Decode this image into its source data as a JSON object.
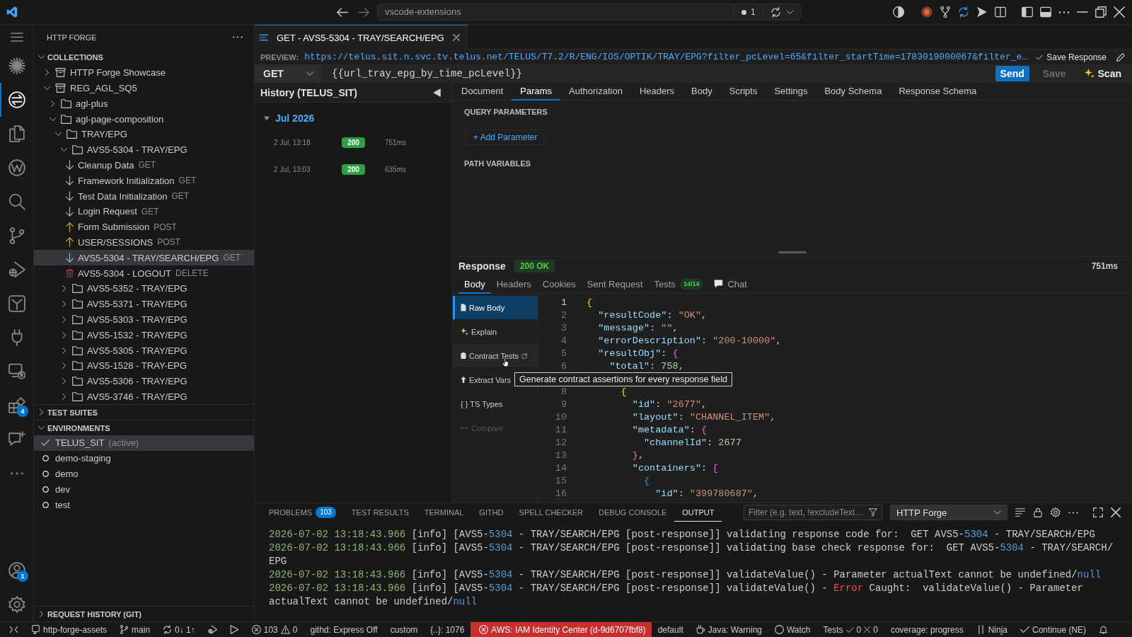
{
  "title_bar": {
    "search": "vscode-extensions",
    "indicator": "1"
  },
  "activity_bar": {
    "items": [
      {
        "kind": "menu",
        "selected": false
      },
      {
        "kind": "sparkle",
        "selected": false
      },
      {
        "kind": "forge",
        "selected": true
      },
      {
        "kind": "files",
        "selected": false
      },
      {
        "kind": "wiki",
        "selected": false
      },
      {
        "kind": "search",
        "selected": false
      },
      {
        "kind": "branch",
        "selected": false
      },
      {
        "kind": "debug",
        "selected": false
      },
      {
        "kind": "tile",
        "selected": false
      },
      {
        "kind": "plug",
        "selected": false
      },
      {
        "kind": "remote",
        "selected": false
      },
      {
        "kind": "extensions",
        "selected": false,
        "badge": "4"
      },
      {
        "kind": "chat",
        "selected": false
      },
      {
        "kind": "more",
        "selected": false
      }
    ],
    "bottom_items": [
      {
        "kind": "account",
        "badge": "1"
      },
      {
        "kind": "settings"
      }
    ]
  },
  "sidebar": {
    "title": "HTTP FORGE",
    "collections": {
      "title": "COLLECTIONS",
      "expanded": true,
      "items": [
        {
          "kind": "collection",
          "label": "HTTP Forge Showcase",
          "expanded": false,
          "selected": false
        },
        {
          "kind": "collection",
          "label": "REG_AGL_SQ5",
          "expanded": true,
          "selected": false,
          "children": [
            {
              "kind": "folder",
              "label": "agl-plus",
              "expanded": false,
              "selected": false
            },
            {
              "kind": "folder",
              "label": "agl-page-composition",
              "expanded": true,
              "selected": false,
              "children": [
                {
                  "kind": "folder",
                  "label": "TRAY/EPG",
                  "expanded": true,
                  "selected": false,
                  "children": [
                    {
                      "kind": "folder",
                      "label": "AVS5-5304 - TRAY/EPG",
                      "expanded": true,
                      "selected": false,
                      "children": [
                        {
                          "kind": "get",
                          "label": "Cleanup Data",
                          "method": "GET",
                          "selected": false
                        },
                        {
                          "kind": "get",
                          "label": "Framework Initialization",
                          "method": "GET",
                          "selected": false
                        },
                        {
                          "kind": "get",
                          "label": "Test Data Initialization",
                          "method": "GET",
                          "selected": false
                        },
                        {
                          "kind": "get",
                          "label": "Login Request",
                          "method": "GET",
                          "selected": false
                        },
                        {
                          "kind": "post",
                          "label": "Form Submission",
                          "method": "POST",
                          "selected": false
                        },
                        {
                          "kind": "post",
                          "label": "USER/SESSIONS",
                          "method": "POST",
                          "selected": false
                        },
                        {
                          "kind": "get",
                          "label": "AVS5-5304 - TRAY/SEARCH/EPG",
                          "method": "GET",
                          "selected": true
                        },
                        {
                          "kind": "delete",
                          "label": "AVS5-5304 - LOGOUT",
                          "method": "DELETE",
                          "selected": false
                        }
                      ]
                    },
                    {
                      "kind": "folder",
                      "label": "AVS5-5352 - TRAY/EPG",
                      "expanded": false,
                      "selected": false
                    },
                    {
                      "kind": "folder",
                      "label": "AVS5-5371 - TRAY/EPG",
                      "expanded": false,
                      "selected": false
                    },
                    {
                      "kind": "folder",
                      "label": "AVS5-5303 - TRAY/EPG",
                      "expanded": false,
                      "selected": false
                    },
                    {
                      "kind": "folder",
                      "label": "AVS5-1532 - TRAY/EPG",
                      "expanded": false,
                      "selected": false
                    },
                    {
                      "kind": "folder",
                      "label": "AVS5-5305 - TRAY/EPG",
                      "expanded": false,
                      "selected": false
                    },
                    {
                      "kind": "folder",
                      "label": "AVS5-1528 - TRAY-EPG",
                      "expanded": false,
                      "selected": false
                    },
                    {
                      "kind": "folder",
                      "label": "AVS5-5306 - TRAY/EPG",
                      "expanded": false,
                      "selected": false
                    },
                    {
                      "kind": "folder",
                      "label": "AVS5-3746 - TRAY/EPG",
                      "expanded": false,
                      "selected": false
                    }
                  ]
                }
              ]
            }
          ]
        }
      ]
    },
    "test_suites": {
      "title": "TEST SUITES",
      "expanded": false
    },
    "environments": {
      "title": "ENVIRONMENTS",
      "expanded": true,
      "items": [
        {
          "name": "TELUS_SIT",
          "note": "(active)",
          "selected": true
        },
        {
          "name": "demo-staging",
          "selected": false
        },
        {
          "name": "demo",
          "selected": false
        },
        {
          "name": "dev",
          "selected": false
        },
        {
          "name": "test",
          "selected": false
        }
      ]
    },
    "request_history": {
      "title": "REQUEST HISTORY (GIT)",
      "expanded": false
    }
  },
  "editor": {
    "tabs": [
      {
        "label": "GET - AVS5-5304 - TRAY/SEARCH/EPG",
        "selected": true
      }
    ],
    "preview": {
      "label": "PREVIEW:",
      "url": "https://telus.sit.n.svc.tv.telus.net/TELUS/T7.2/R/ENG/IOS/OPTIK/TRAY/EPG?filter_pcLevel=65&filter_startTime=1783019000067&filter_e…",
      "save_response": {
        "label": "Save Response",
        "checked": true
      }
    },
    "request": {
      "method": "GET",
      "url": "{{url_tray_epg_by_time_pcLevel}}",
      "actions": [
        {
          "label": "Send",
          "kind": "primary",
          "disabled": false
        },
        {
          "label": "Save",
          "kind": "plain",
          "disabled": true
        },
        {
          "label": "Scan",
          "kind": "ai",
          "disabled": false
        }
      ]
    },
    "history": {
      "title": "History (TELUS_SIT)",
      "groups": [
        {
          "label": "Jul 2026",
          "expanded": true,
          "entries": [
            {
              "time": "2 Jul, 13:18",
              "status": "200",
              "duration": "751ms"
            },
            {
              "time": "2 Jul, 13:03",
              "status": "200",
              "duration": "635ms"
            }
          ]
        }
      ]
    },
    "request_tabs": [
      {
        "label": "Document",
        "selected": false
      },
      {
        "label": "Params",
        "selected": true
      },
      {
        "label": "Authorization",
        "selected": false
      },
      {
        "label": "Headers",
        "selected": false
      },
      {
        "label": "Body",
        "selected": false
      },
      {
        "label": "Scripts",
        "selected": false
      },
      {
        "label": "Settings",
        "selected": false
      },
      {
        "label": "Body Schema",
        "selected": false
      },
      {
        "label": "Response Schema",
        "selected": false
      }
    ],
    "params": {
      "sections": [
        {
          "title": "QUERY PARAMETERS",
          "action": "+ Add Parameter"
        },
        {
          "title": "PATH VARIABLES"
        }
      ]
    },
    "response": {
      "title": "Response",
      "status": "200 OK",
      "time": "751ms",
      "tabs": [
        {
          "label": "Body",
          "kind": "view",
          "selected": true
        },
        {
          "label": "Headers",
          "kind": "view",
          "selected": false
        },
        {
          "label": "Cookies",
          "kind": "view",
          "selected": false
        },
        {
          "label": "Sent Request",
          "kind": "view",
          "selected": false
        },
        {
          "label": "Tests",
          "kind": "view",
          "badge": "14/14",
          "selected": false
        },
        {
          "label": "Chat",
          "kind": "chat",
          "selected": false
        }
      ],
      "actions": [
        {
          "label": "Raw Body",
          "kind": "page",
          "selected": true,
          "hovered": false,
          "disabled": false,
          "loading": false
        },
        {
          "label": "Explain",
          "kind": "sparkle",
          "selected": false,
          "hovered": false,
          "disabled": false,
          "loading": false
        },
        {
          "label": "Contract Tests",
          "kind": "clipboard",
          "selected": false,
          "hovered": true,
          "disabled": false,
          "loading": true
        },
        {
          "label": "Extract Vars",
          "kind": "upload",
          "selected": false,
          "hovered": false,
          "disabled": false,
          "loading": false
        },
        {
          "label": "{ } TS Types",
          "kind": "plain",
          "selected": false,
          "hovered": false,
          "disabled": false,
          "loading": false
        },
        {
          "label": "Compare",
          "kind": "arrows",
          "selected": false,
          "hovered": false,
          "disabled": true,
          "loading": false
        }
      ],
      "viewer": {
        "rows": [
          {
            "kind": "line",
            "number": "1",
            "text": "{",
            "current": true
          },
          {
            "kind": "line",
            "number": "2",
            "text": "  \"resultCode\": \"OK\",",
            "current": false
          },
          {
            "kind": "line",
            "number": "3",
            "text": "  \"message\": \"\",",
            "current": false
          },
          {
            "kind": "line",
            "number": "4",
            "text": "  \"errorDescription\": \"200-10000\",",
            "current": false
          },
          {
            "kind": "line",
            "number": "5",
            "text": "  \"resultObj\": {",
            "current": false
          },
          {
            "kind": "line",
            "number": "6",
            "text": "    \"total\": 758,",
            "current": false
          },
          {
            "kind": "tooltip",
            "text": "Generate contract assertions for every response field"
          },
          {
            "kind": "line",
            "number": "8",
            "text": "      {",
            "current": false
          },
          {
            "kind": "line",
            "number": "9",
            "text": "        \"id\": \"2677\",",
            "current": false
          },
          {
            "kind": "line",
            "number": "10",
            "text": "        \"layout\": \"CHANNEL_ITEM\",",
            "current": false
          },
          {
            "kind": "line",
            "number": "11",
            "text": "        \"metadata\": {",
            "current": false
          },
          {
            "kind": "line",
            "number": "12",
            "text": "          \"channelId\": 2677",
            "current": false
          },
          {
            "kind": "line",
            "number": "13",
            "text": "        },",
            "current": false
          },
          {
            "kind": "line",
            "number": "14",
            "text": "        \"containers\": [",
            "current": false
          },
          {
            "kind": "line",
            "number": "15",
            "text": "          {",
            "current": false
          },
          {
            "kind": "line",
            "number": "16",
            "text": "            \"id\": \"399780687\",",
            "current": false
          }
        ]
      }
    }
  },
  "panel": {
    "tabs": [
      {
        "label": "PROBLEMS",
        "badge": "103",
        "selected": false
      },
      {
        "label": "TEST RESULTS",
        "selected": false
      },
      {
        "label": "TERMINAL",
        "selected": false
      },
      {
        "label": "GITHD",
        "selected": false
      },
      {
        "label": "SPELL CHECKER",
        "selected": false
      },
      {
        "label": "DEBUG CONSOLE",
        "selected": false
      },
      {
        "label": "OUTPUT",
        "selected": true
      }
    ],
    "filter": {
      "placeholder": "Filter (e.g. text, !excludeText…"
    },
    "channel": "HTTP Forge",
    "lines": [
      {
        "segments": [
          {
            "kind": "time",
            "text": "2026-07-02 13:18:43.966"
          },
          {
            "kind": "plain",
            "text": " [info] [AVS5-"
          },
          {
            "kind": "number",
            "text": "5304"
          },
          {
            "kind": "plain",
            "text": " - TRAY/SEARCH/EPG [post-response]] validating response code for:  GET AVS5-"
          },
          {
            "kind": "number",
            "text": "5304"
          },
          {
            "kind": "plain",
            "text": " - TRAY/SEARCH/EPG"
          }
        ]
      },
      {
        "segments": [
          {
            "kind": "time",
            "text": "2026-07-02 13:18:43.966"
          },
          {
            "kind": "plain",
            "text": " [info] [AVS5-"
          },
          {
            "kind": "number",
            "text": "5304"
          },
          {
            "kind": "plain",
            "text": " - TRAY/SEARCH/EPG [post-response]] validating base check response for:  GET AVS5-"
          },
          {
            "kind": "number",
            "text": "5304"
          },
          {
            "kind": "plain",
            "text": " - TRAY/SEARCH/EPG"
          }
        ]
      },
      {
        "segments": [
          {
            "kind": "time",
            "text": "2026-07-02 13:18:43.966"
          },
          {
            "kind": "plain",
            "text": " [info] [AVS5-"
          },
          {
            "kind": "number",
            "text": "5304"
          },
          {
            "kind": "plain",
            "text": " - TRAY/SEARCH/EPG [post-response]] validateValue() - Parameter actualText cannot be undefined/"
          },
          {
            "kind": "number",
            "text": "null"
          }
        ]
      },
      {
        "segments": [
          {
            "kind": "time",
            "text": "2026-07-02 13:18:43.966"
          },
          {
            "kind": "plain",
            "text": " [info] [AVS5-"
          },
          {
            "kind": "number",
            "text": "5304"
          },
          {
            "kind": "plain",
            "text": " - TRAY/SEARCH/EPG [post-response]] validateValue() - "
          },
          {
            "kind": "error",
            "text": "Error"
          },
          {
            "kind": "plain",
            "text": " Caught:  validateValue() - Parameter actualText cannot be undefined/"
          },
          {
            "kind": "number",
            "text": "null"
          }
        ]
      }
    ]
  },
  "status_bar": {
    "items": [
      {
        "kind": "remote"
      },
      {
        "kind": "repo",
        "text": "http-forge-assets"
      },
      {
        "kind": "branch",
        "text": "main"
      },
      {
        "kind": "sync",
        "text": "0↓ 1↑"
      },
      {
        "kind": "debugger"
      },
      {
        "kind": "run"
      },
      {
        "kind": "problems",
        "errors": "103",
        "warnings": "0"
      },
      {
        "kind": "plain",
        "text": "githd: Express Off"
      },
      {
        "kind": "plain",
        "text": "custom"
      },
      {
        "kind": "plain",
        "text": "{..}: 1076"
      },
      {
        "kind": "error",
        "text": "AWS: IAM Identity Center (d-9d6707fbf8)"
      },
      {
        "kind": "plain",
        "text": "default"
      },
      {
        "kind": "java",
        "text": "Java: Warning"
      },
      {
        "kind": "watch",
        "text": "Watch"
      },
      {
        "kind": "tests",
        "text": "Tests",
        "passed": "0",
        "failed": "0"
      },
      {
        "kind": "plain",
        "text": "coverage: progress"
      },
      {
        "kind": "ninja",
        "text": "Ninja"
      },
      {
        "kind": "check",
        "text": "Continue (NE)"
      },
      {
        "kind": "bell"
      }
    ]
  }
}
